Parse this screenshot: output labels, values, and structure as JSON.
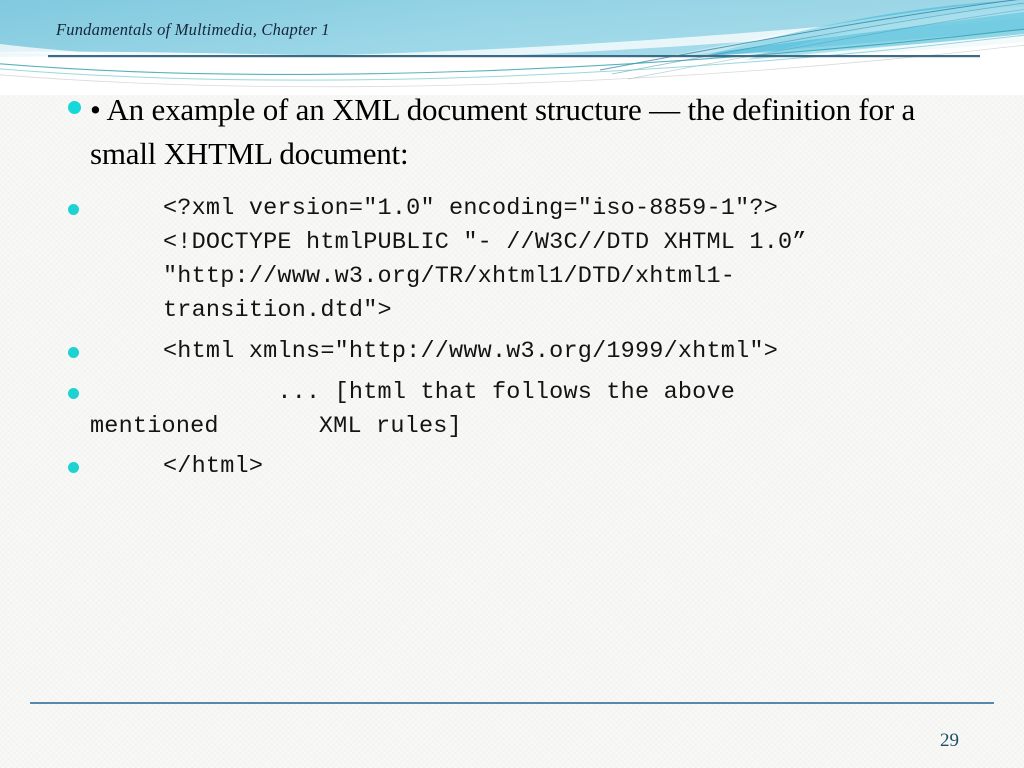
{
  "header": {
    "title": "Fundamentals of Multimedia, Chapter 1",
    "rule_color": "#3d6b86",
    "band_color_left": "#7fc9de",
    "band_color_right": "#a9dcea"
  },
  "bullet_color": "#16d8d8",
  "body": {
    "lead_bullet": {
      "marker": "•",
      "text": "An example of an XML document structure — the definition for a small XHTML document:"
    },
    "code_blocks": [
      {
        "has_bullet": true,
        "lines": [
          "<?xml version=\"1.0\" encoding=\"iso-8859-1\"?>",
          "<!DOCTYPE htmlPUBLIC \"- //W3C//DTD XHTML 1.0”",
          "\"http://www.w3.org/TR/xhtml1/DTD/xhtml1-",
          "transition.dtd\">"
        ]
      },
      {
        "has_bullet": true,
        "lines": [
          "<html xmlns=\"http://www.w3.org/1999/xhtml\">"
        ]
      },
      {
        "has_bullet": true,
        "lines": [
          "        ... [html that follows the above"
        ],
        "wrap_line": "mentioned       XML rules]"
      },
      {
        "has_bullet": true,
        "lines": [
          "</html>"
        ]
      }
    ]
  },
  "footer": {
    "page_number": "29",
    "rule_color": "#5b87a8",
    "page_number_color": "#1f4e66"
  }
}
